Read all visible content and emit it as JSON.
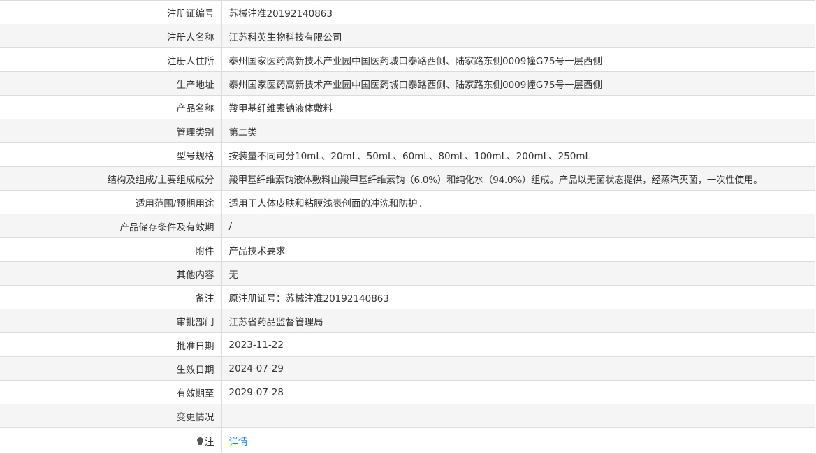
{
  "record": {
    "reg_no": {
      "label": "注册证编号",
      "value": "苏械注准20192140863"
    },
    "registrant_name": {
      "label": "注册人名称",
      "value": "江苏科英生物科技有限公司"
    },
    "registrant_address": {
      "label": "注册人住所",
      "value": "泰州国家医药高新技术产业园中国医药城口泰路西侧、陆家路东侧0009幢G75号一层西侧"
    },
    "production_address": {
      "label": "生产地址",
      "value": "泰州国家医药高新技术产业园中国医药城口泰路西侧、陆家路东侧0009幢G75号一层西侧"
    },
    "product_name": {
      "label": "产品名称",
      "value": "羧甲基纤维素钠液体敷料"
    },
    "management_class": {
      "label": "管理类别",
      "value": "第二类"
    },
    "model_spec": {
      "label": "型号规格",
      "value": "按装量不同可分10mL、20mL、50mL、60mL、80mL、100mL、200mL、250mL"
    },
    "composition": {
      "label": "结构及组成/主要组成成分",
      "value": "羧甲基纤维素钠液体敷料由羧甲基纤维素钠（6.0%）和纯化水（94.0%）组成。产品以无菌状态提供，经蒸汽灭菌，一次性使用。"
    },
    "intended_use": {
      "label": "适用范围/预期用途",
      "value": "适用于人体皮肤和粘膜浅表创面的冲洗和防护。"
    },
    "storage": {
      "label": "产品储存条件及有效期",
      "value": "/"
    },
    "attachment": {
      "label": "附件",
      "value": "产品技术要求"
    },
    "other": {
      "label": "其他内容",
      "value": "无"
    },
    "remark": {
      "label": "备注",
      "value": "原注册证号：苏械注准20192140863"
    },
    "approval_dept": {
      "label": "审批部门",
      "value": "江苏省药品监督管理局"
    },
    "approval_date": {
      "label": "批准日期",
      "value": "2023-11-22"
    },
    "effective_date": {
      "label": "生效日期",
      "value": "2024-07-29"
    },
    "valid_until": {
      "label": "有效期至",
      "value": "2029-07-28"
    },
    "change_info": {
      "label": "变更情况",
      "value": ""
    },
    "note": {
      "label": "注",
      "icon": "lightbulb-icon",
      "link_text": "详情"
    }
  },
  "colors": {
    "row_alt_background": "#f5f5f5",
    "border": "#dcdcdc",
    "text": "#333333",
    "link": "#2a7fd4"
  }
}
